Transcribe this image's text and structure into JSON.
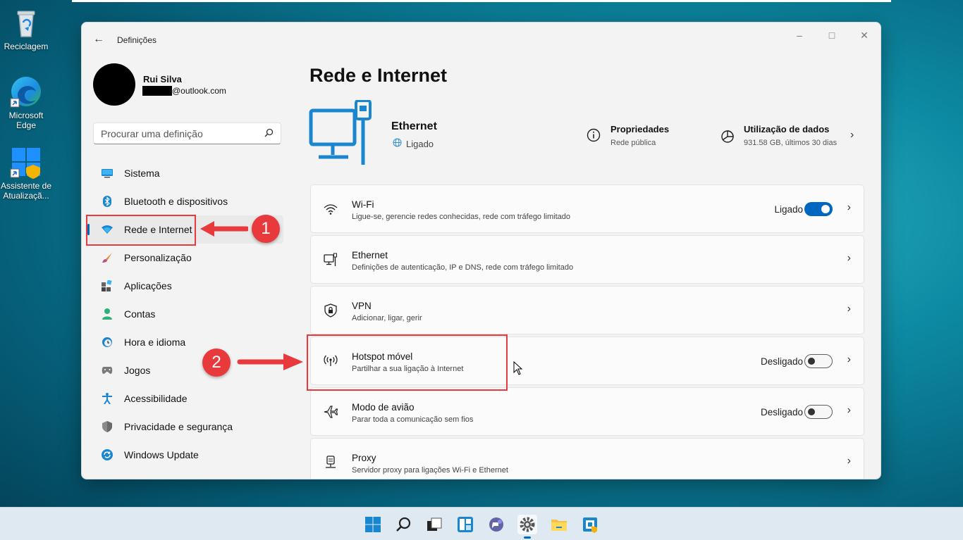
{
  "desktop": {
    "icons": [
      {
        "label": "Reciclagem"
      },
      {
        "label": "Microsoft Edge"
      },
      {
        "label": "Assistente de Atualizaçã..."
      }
    ]
  },
  "window": {
    "title": "Definições",
    "user": {
      "name": "Rui Silva",
      "email_suffix": "@outlook.com"
    },
    "search": {
      "placeholder": "Procurar uma definição"
    }
  },
  "nav": {
    "items": [
      {
        "label": "Sistema",
        "icon": "monitor-icon"
      },
      {
        "label": "Bluetooth e dispositivos",
        "icon": "bluetooth-icon"
      },
      {
        "label": "Rede e Internet",
        "icon": "wifi-icon",
        "active": true
      },
      {
        "label": "Personalização",
        "icon": "brush-icon"
      },
      {
        "label": "Aplicações",
        "icon": "apps-icon"
      },
      {
        "label": "Contas",
        "icon": "person-icon"
      },
      {
        "label": "Hora e idioma",
        "icon": "clock-globe-icon"
      },
      {
        "label": "Jogos",
        "icon": "gamepad-icon"
      },
      {
        "label": "Acessibilidade",
        "icon": "accessibility-icon"
      },
      {
        "label": "Privacidade e segurança",
        "icon": "shield-icon"
      },
      {
        "label": "Windows Update",
        "icon": "update-icon"
      }
    ]
  },
  "main": {
    "title": "Rede e Internet",
    "connection": {
      "name": "Ethernet",
      "status": "Ligado"
    },
    "properties": {
      "title": "Propriedades",
      "subtitle": "Rede pública"
    },
    "usage": {
      "title": "Utilização de dados",
      "subtitle": "931.58 GB, últimos 30 dias"
    },
    "cards": [
      {
        "title": "Wi-Fi",
        "subtitle": "Ligue-se, gerencie redes conhecidas, rede com tráfego limitado",
        "state": "Ligado",
        "toggle": "on"
      },
      {
        "title": "Ethernet",
        "subtitle": "Definições de autenticação, IP e DNS, rede com tráfego limitado"
      },
      {
        "title": "VPN",
        "subtitle": "Adicionar, ligar, gerir"
      },
      {
        "title": "Hotspot móvel",
        "subtitle": "Partilhar a sua ligação à Internet",
        "state": "Desligado",
        "toggle": "off"
      },
      {
        "title": "Modo de avião",
        "subtitle": "Parar toda a comunicação sem fios",
        "state": "Desligado",
        "toggle": "off"
      },
      {
        "title": "Proxy",
        "subtitle": "Servidor proxy para ligações Wi-Fi e Ethernet"
      }
    ]
  },
  "annotations": {
    "step1": "1",
    "step2": "2"
  },
  "colors": {
    "accent": "#0067c0",
    "annotation": "#e8393c"
  }
}
